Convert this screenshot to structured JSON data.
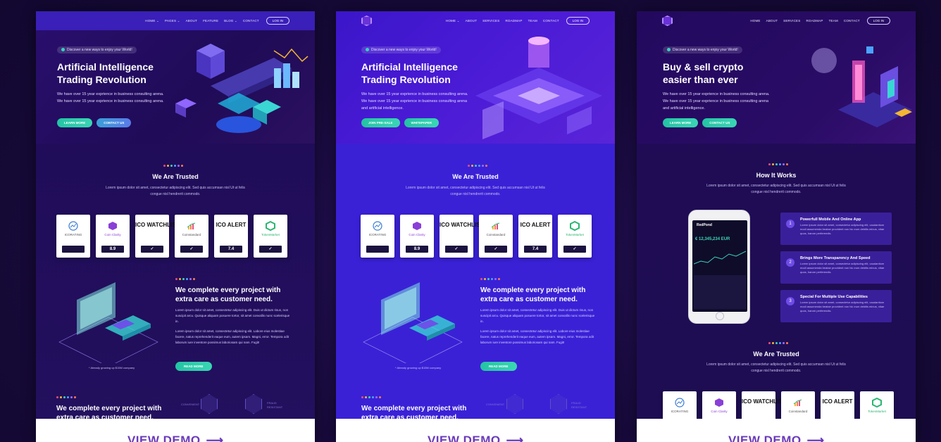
{
  "colors": {
    "accent_green": "#3ad6b4",
    "accent_purple": "#6a3aba",
    "dots": [
      "#e94d7b",
      "#f2b632",
      "#3ad6b4",
      "#4aa3ff",
      "#9b6cff",
      "#ff7a4d"
    ]
  },
  "cards": [
    {
      "nav": {
        "items": [
          "HOME ⌄",
          "PAGES ⌄",
          "ABOUT",
          "FEATURE",
          "BLOG ⌄",
          "CONTACT"
        ],
        "login": "LOG IN"
      },
      "hero": {
        "pill": "Discover a new ways to enjoy your World!",
        "title": "Artificial Intelligence Trading Revolution",
        "desc": "We have over 15 year exprience in business consulting arena. We have over 15 year exprience in business consulting arena.",
        "btn1": "LEARN MORE",
        "btn2": "CONTACT US"
      },
      "trusted": {
        "title": "We Are Trusted",
        "desc": "Lorem ipsum dolor sit amet, consectetur adipiscing elit. Sed quis accumsan nisl Ut ut felis congue nisl hendrerit commodo."
      },
      "feature": {
        "title": "We complete every project with extra care as customer need.",
        "desc1": "Lorem ipsum dolor sit amet, consectetur adipiscing elit. Duis ut dictum risus, non suscipit arcu. Quisque aliquam posuere tortor, sit amet convallis nunc scelerisque in.",
        "desc2": "Lorem ipsum dolor sit amet, consectetur adipiscing elit. Labore eius molestiae facere, natus reprehenderit eaque eum, autem ipsam. Magni, error. Tempora odit laborum iure inventore possimus laboriosam qui nam. Fugit!",
        "button": "READ MORE",
        "caption": "* Already growing up $15M company"
      },
      "bottom": {
        "title": "We complete every project with extra care as customer need.",
        "hex1": "CONVENIENT",
        "hex2": "FRAUD RESISTANT"
      },
      "view_demo": "VIEW DEMO"
    },
    {
      "nav": {
        "items": [
          "HOME ⌄",
          "ABOUT",
          "SERVICES",
          "ROADMAP",
          "TEAM",
          "CONTACT"
        ],
        "login": "LOG IN"
      },
      "hero": {
        "pill": "Discover a new ways to enjoy your World!",
        "title": "Artificial Intelligence Trading Revolution",
        "desc": "We have over 15 year exprience in business consulting arena. We have over 15 year exprience in business consulting arena and artificial intelligence.",
        "btn1": "JOIN PRE-SALE",
        "btn2": "WHITEPAPER"
      },
      "trusted": {
        "title": "We Are Trusted",
        "desc": "Lorem ipsum dolor sit amet, consectetur adipiscing elit. Sed quis accumsan nisl Ut ut felis congue nisl hendrerit commodo."
      },
      "feature": {
        "title": "We complete every project with extra care as customer need.",
        "desc1": "Lorem ipsum dolor sit amet, consectetur adipiscing elit. Duis ut dictum risus, non suscipit arcu. Quisque aliquam posuere tortor, sit amet convallis nunc scelerisque in.",
        "desc2": "Lorem ipsum dolor sit amet, consectetur adipiscing elit. Labore eius molestiae facere, natus reprehenderit eaque eum, autem ipsam. Magni, error. Tempora odit laborum iure inventore possimus laboriosam qui nam. Fugit!",
        "button": "READ MORE",
        "caption": "* Already growing up $15M company"
      },
      "bottom": {
        "title": "We complete every project with extra care as customer need.",
        "hex1": "CONVENIENT",
        "hex2": "FRAUD RESISTANT"
      },
      "view_demo": "VIEW DEMO"
    },
    {
      "nav": {
        "items": [
          "HOME",
          "ABOUT",
          "SERVICES",
          "ROADMAP",
          "TEAM",
          "CONTACT"
        ],
        "login": "LOG IN"
      },
      "hero": {
        "pill": "Discover a new ways to enjoy your World!",
        "title": "Buy & sell crypto easier than ever",
        "desc": "We have over 15 year exprience in business consulting arena. We have over 15 year exprience in business consulting arena and artificial intelligence.",
        "btn1": "LEARN MORE",
        "btn2": "CONTACT US"
      },
      "how": {
        "title": "How It Works",
        "desc": "Lorem ipsum dolor sit amet, consectetur adipiscing elit. Sed quis accumsan nisl Ut ut felis congue nisl hendrerit commodo.",
        "phone_brand": "RedPond",
        "phone_price": "€ 12,345,234 EUR",
        "steps": [
          {
            "num": "1",
            "title": "Powerfull Mobile And Online App",
            "desc": "Lorem ipsum dolor sit amet, consectetur adipiscing elit, caudantium modi assumenda beatae provident non hic eum debitis minus, vitae quos, harum perferendis."
          },
          {
            "num": "2",
            "title": "Brings More Transparency And Speed",
            "desc": "Lorem ipsum dolor sit amet, consectetur adipiscing elit, caudantium modi assumenda beatae provident non hic eum debitis minus, vitae quos, harum perferendis."
          },
          {
            "num": "3",
            "title": "Special For Multiple Use Capabilities",
            "desc": "Lorem ipsum dolor sit amet, consectetur adipiscing elit, caudantium modi assumenda beatae provident non hic eum debitis minus, vitae quos, harum perferendis."
          }
        ]
      },
      "trusted": {
        "title": "We Are Trusted",
        "desc": "Lorem ipsum dolor sit amet, consectetur adipiscing elit. Sed quis accumsan nisl Ut ut felis congue nisl hendrerit commodo."
      },
      "view_demo": "VIEW DEMO"
    }
  ],
  "logos": [
    {
      "name": "ICORATING",
      "big": "",
      "score": "",
      "icon": "icorating-icon"
    },
    {
      "name": "Coin Clarity",
      "big": "",
      "score": "8.9",
      "icon": "coin-clarity-icon"
    },
    {
      "name": "",
      "big": "ICO WATCHLIST",
      "score": "✓",
      "icon": ""
    },
    {
      "name": "Coinstandard",
      "big": "",
      "score": "✓",
      "icon": "coinstandard-icon"
    },
    {
      "name": "",
      "big": "ICO ALERT",
      "score": "7.4",
      "icon": ""
    },
    {
      "name": "TokenMarket",
      "big": "",
      "score": "✓",
      "icon": "tokenmarket-icon"
    }
  ]
}
